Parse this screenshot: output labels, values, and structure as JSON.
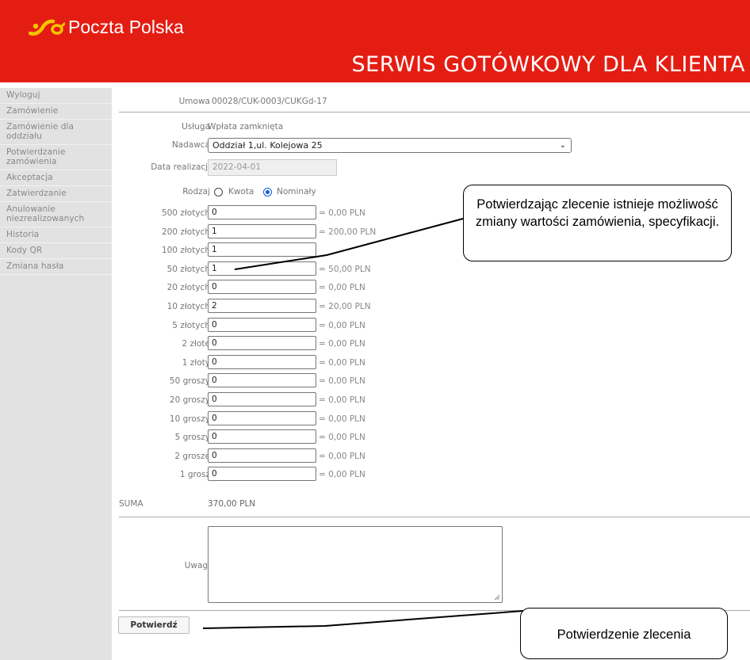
{
  "brand": {
    "name": "Poczta Polska",
    "service_title": "SERWIS GOTÓWKOWY DLA KLIENTA",
    "color": "#e41d13",
    "logo_color": "#f5c400"
  },
  "sidebar": {
    "items": [
      {
        "label": "Wyloguj"
      },
      {
        "label": "Zamówienie"
      },
      {
        "label": "Zamówienie dla oddziału"
      },
      {
        "label": "Potwierdzanie zamówienia"
      },
      {
        "label": "Akceptacja"
      },
      {
        "label": "Zatwierdzanie"
      },
      {
        "label": "Anulowanie niezrealizowanych"
      },
      {
        "label": "Historia"
      },
      {
        "label": "Kody QR"
      },
      {
        "label": "Zmiana hasła"
      }
    ]
  },
  "form": {
    "contract_label": "Umowa",
    "contract_value": "00028/CUK-0003/CUKGd-17",
    "service_label": "Usługa",
    "service_value": "Wpłata zamknięta",
    "sender_label": "Nadawca",
    "sender_value": "Oddział 1,ul. Kolejowa 25",
    "date_label": "Data realizacji",
    "date_value": "2022-04-01",
    "type_label": "Rodzaj",
    "type_option_amount": "Kwota",
    "type_option_denominations": "Nominały",
    "type_selected": "Nominały",
    "denominations": [
      {
        "label": "500 złotych",
        "count": "0",
        "subtotal": "= 0,00 PLN"
      },
      {
        "label": "200 złotych",
        "count": "1",
        "subtotal": "= 200,00 PLN"
      },
      {
        "label": "100 złotych",
        "count": "1",
        "subtotal": ""
      },
      {
        "label": "50 złotych",
        "count": "1",
        "subtotal": "= 50,00 PLN"
      },
      {
        "label": "20 złotych",
        "count": "0",
        "subtotal": "= 0,00 PLN"
      },
      {
        "label": "10 złotych",
        "count": "2",
        "subtotal": "= 20,00 PLN"
      },
      {
        "label": "5 złotych",
        "count": "0",
        "subtotal": "= 0,00 PLN"
      },
      {
        "label": "2 złote",
        "count": "0",
        "subtotal": "= 0,00 PLN"
      },
      {
        "label": "1 złoty",
        "count": "0",
        "subtotal": "= 0,00 PLN"
      },
      {
        "label": "50 groszy",
        "count": "0",
        "subtotal": "= 0,00 PLN"
      },
      {
        "label": "20 groszy",
        "count": "0",
        "subtotal": "= 0,00 PLN"
      },
      {
        "label": "10 groszy",
        "count": "0",
        "subtotal": "= 0,00 PLN"
      },
      {
        "label": "5 groszy",
        "count": "0",
        "subtotal": "= 0,00 PLN"
      },
      {
        "label": "2 grosze",
        "count": "0",
        "subtotal": "= 0,00 PLN"
      },
      {
        "label": "1 grosz",
        "count": "0",
        "subtotal": "= 0,00 PLN"
      }
    ],
    "sum_label": "SUMA",
    "sum_value": "370,00 PLN",
    "notes_label": "Uwagi",
    "notes_value": "",
    "confirm_label": "Potwierdź"
  },
  "callouts": {
    "edit_note": "Potwierdzając zlecenie istnieje możliwość zmiany wartości zamówienia, specyfikacji.",
    "confirm_note": "Potwierdzenie zlecenia"
  }
}
